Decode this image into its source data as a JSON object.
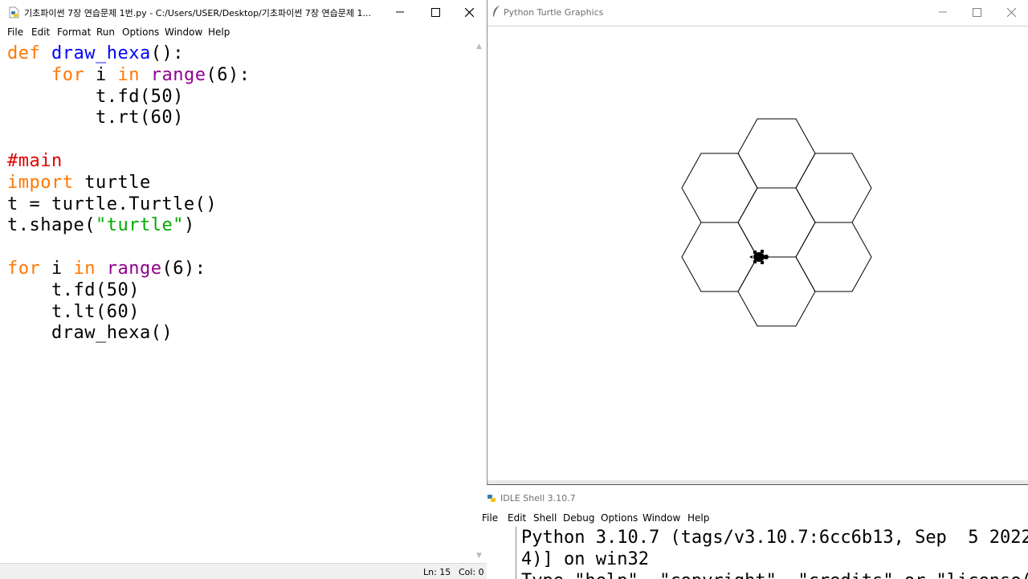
{
  "editor": {
    "title": "기초파이썬 7장 연습문제 1번.py - C:/Users/USER/Desktop/기초파이썬 7장 연습문제 1...",
    "menu": [
      "File",
      "Edit",
      "Format",
      "Run",
      "Options",
      "Window",
      "Help"
    ],
    "code_lines": [
      [
        {
          "t": "def ",
          "c": "kw"
        },
        {
          "t": "draw_hexa",
          "c": "fn"
        },
        {
          "t": "():",
          "c": ""
        }
      ],
      [
        {
          "t": "    ",
          "c": ""
        },
        {
          "t": "for",
          "c": "kw"
        },
        {
          "t": " i ",
          "c": ""
        },
        {
          "t": "in",
          "c": "kw"
        },
        {
          "t": " ",
          "c": ""
        },
        {
          "t": "range",
          "c": "bi"
        },
        {
          "t": "(6):",
          "c": ""
        }
      ],
      [
        {
          "t": "        t.fd(50)",
          "c": ""
        }
      ],
      [
        {
          "t": "        t.rt(60)",
          "c": ""
        }
      ],
      [],
      [
        {
          "t": "#main",
          "c": "cm"
        }
      ],
      [
        {
          "t": "import",
          "c": "kw"
        },
        {
          "t": " turtle",
          "c": ""
        }
      ],
      [
        {
          "t": "t = turtle.Turtle()",
          "c": ""
        }
      ],
      [
        {
          "t": "t.shape(",
          "c": ""
        },
        {
          "t": "\"turtle\"",
          "c": "st"
        },
        {
          "t": ")",
          "c": ""
        }
      ],
      [],
      [
        {
          "t": "for",
          "c": "kw"
        },
        {
          "t": " i ",
          "c": ""
        },
        {
          "t": "in",
          "c": "kw"
        },
        {
          "t": " ",
          "c": ""
        },
        {
          "t": "range",
          "c": "bi"
        },
        {
          "t": "(6):",
          "c": ""
        }
      ],
      [
        {
          "t": "    t.fd(50)",
          "c": ""
        }
      ],
      [
        {
          "t": "    t.lt(60)",
          "c": ""
        }
      ],
      [
        {
          "t": "    draw_hexa()",
          "c": ""
        }
      ]
    ],
    "status": {
      "line": "Ln: 15",
      "col": "Col: 0"
    }
  },
  "turtle_window": {
    "title": "Python Turtle Graphics"
  },
  "shell": {
    "title": "IDLE Shell 3.10.7",
    "menu": [
      "File",
      "Edit",
      "Shell",
      "Debug",
      "Options",
      "Window",
      "Help"
    ],
    "lines": [
      "Python 3.10.7 (tags/v3.10.7:6cc6b13, Sep  5 2022",
      "4)] on win32",
      "Type \"help\", \"copyright\", \"credits\" or \"license()"
    ]
  },
  "colors": {
    "keyword": "#ff7700",
    "function_name": "#0000ff",
    "builtin": "#900090",
    "comment": "#dd0000",
    "string": "#00aa00"
  }
}
